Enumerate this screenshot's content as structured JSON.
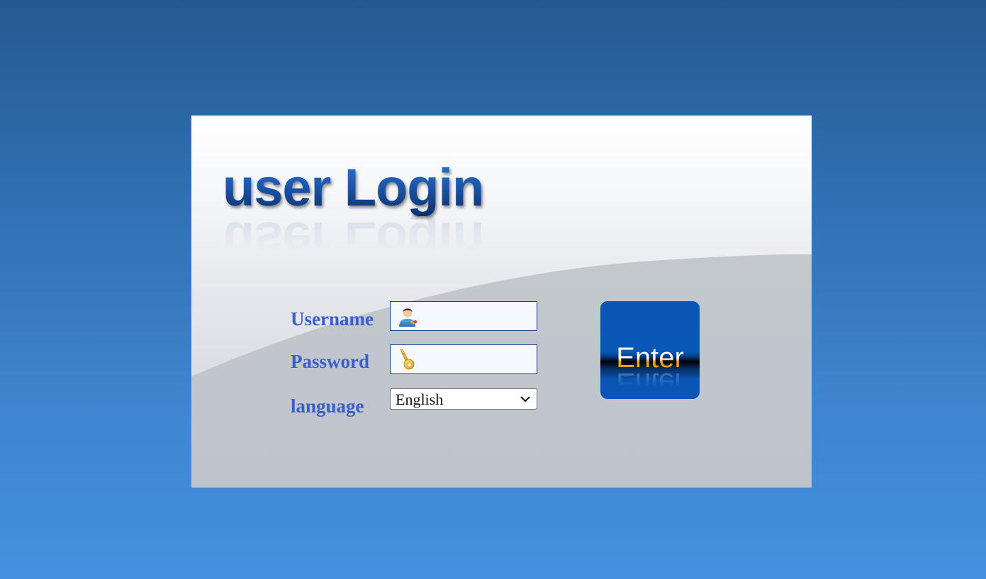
{
  "login": {
    "title": "user Login",
    "username_label": "Username",
    "password_label": "Password",
    "language_label": "language",
    "username_value": "",
    "password_value": "",
    "language_selected": "English",
    "enter_label": "Enter"
  },
  "icons": {
    "username": "user-icon",
    "password": "key-icon",
    "language_dropdown": "chevron-down-icon"
  },
  "colors": {
    "label": "#3a5fcd",
    "field_border": "#1c3f94",
    "field_bg": "#f5f8fd",
    "enter_bg": "#0a55b5",
    "enter_text_accent": "#f59a10",
    "page_bg_top": "#255a91",
    "page_bg_bottom": "#4690df"
  }
}
